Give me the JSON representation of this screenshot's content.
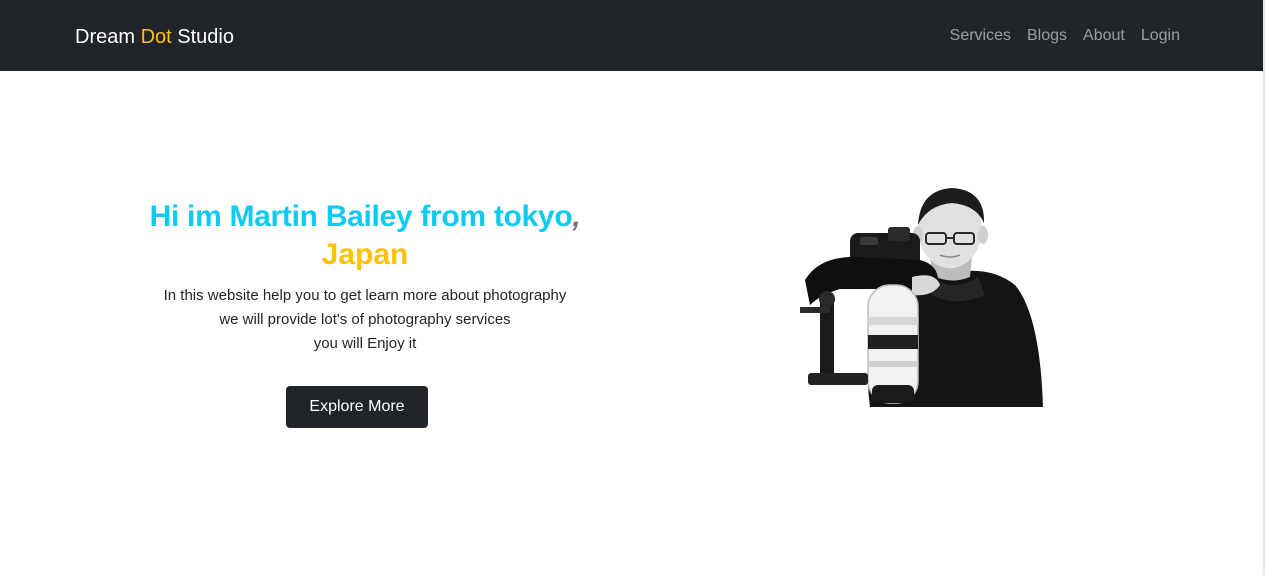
{
  "brand": {
    "part1": "Dream ",
    "accent": "Dot",
    "part2": " Studio"
  },
  "nav": {
    "items": [
      {
        "label": "Services"
      },
      {
        "label": "Blogs"
      },
      {
        "label": "About"
      },
      {
        "label": "Login"
      }
    ]
  },
  "hero": {
    "title": "Hi im Martin Bailey from tokyo",
    "title_comma": ",",
    "subtitle": "Japan",
    "desc_lines": [
      "In this website help you to get learn more about photography",
      "we will provide lot's of photography services",
      "you will Enjoy it"
    ],
    "button_label": "Explore More"
  },
  "colors": {
    "navbar_bg": "#212529",
    "brand_accent": "#ffc107",
    "title": "#0dcaf0",
    "subtitle": "#ffc107",
    "button_bg": "#212529"
  }
}
